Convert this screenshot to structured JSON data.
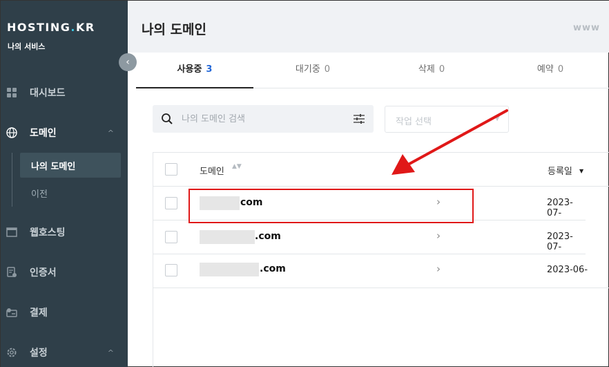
{
  "sidebar": {
    "logo_main": "HOSTING",
    "logo_dot": ".",
    "logo_tail": "KR",
    "service_label": "나의 서비스",
    "collapse_glyph": "‹",
    "items": [
      {
        "label": "대시보드",
        "icon": "dashboard-icon"
      },
      {
        "label": "도메인",
        "icon": "globe-icon",
        "caret": "^"
      },
      {
        "label": "웹호스팅",
        "icon": "window-icon"
      },
      {
        "label": "인증서",
        "icon": "certificate-icon"
      },
      {
        "label": "결제",
        "icon": "payment-icon"
      },
      {
        "label": "설정",
        "icon": "gear-icon",
        "caret": "^"
      }
    ],
    "sub_items": [
      {
        "label": "나의 도메인"
      },
      {
        "label": "이전"
      }
    ]
  },
  "header": {
    "title": "나의 도메인",
    "right_label": "www"
  },
  "tabs": [
    {
      "label": "사용중",
      "count": "3"
    },
    {
      "label": "대기중",
      "count": "0"
    },
    {
      "label": "삭제",
      "count": "0"
    },
    {
      "label": "예약",
      "count": "0"
    }
  ],
  "search": {
    "placeholder": "나의 도메인 검색",
    "icon": "search-icon",
    "filter_icon": "filter-icon"
  },
  "action_select": {
    "placeholder": "작업 선택",
    "icon": "chevron-down-icon"
  },
  "table": {
    "col_domain": "도메인",
    "col_registered": "등록일",
    "sort_glyph": "▲▼",
    "sort_desc_glyph": "▼",
    "rows": [
      {
        "suffix": "com",
        "date": "2023-07-",
        "go": "›"
      },
      {
        "suffix": ".com",
        "date": "2023-07-",
        "go": "›"
      },
      {
        "suffix": ".com",
        "date": "2023-06-",
        "go": "›"
      }
    ]
  },
  "colors": {
    "sidebar_bg": "#2f3f49",
    "accent_blue": "#2468d8",
    "annotation_red": "#e01818",
    "logo_dot": "#3ec6e0"
  }
}
